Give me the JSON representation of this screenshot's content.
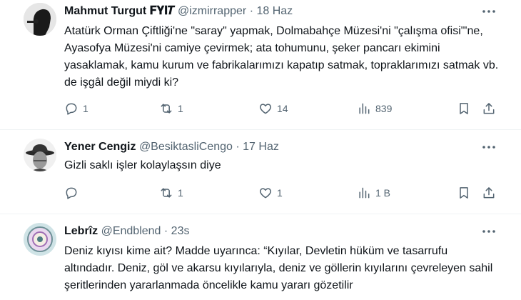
{
  "tweets": [
    {
      "name": "Mahmut Turgut 𝐅𝐘𝐈𝑻",
      "handle": "@izmirrapper",
      "sep": "·",
      "time": "18 Haz",
      "body": "Atatürk Orman Çiftliği'ne \"saray\" yapmak, Dolmabahçe Müzesi'ni \"çalışma ofisi\"'ne, Ayasofya Müzesi'ni camiye çevirmek; ata tohumunu, şeker pancarı ekimini yasaklamak, kamu kurum ve fabrikalarımızı kapatıp satmak, topraklarımızı satmak vb. de işgâl değil miydi ki?",
      "replies": "1",
      "retweets": "1",
      "likes": "14",
      "views": "839"
    },
    {
      "name": "Yener Cengiz",
      "handle": "@BesiktasliCengo",
      "sep": "·",
      "time": "17 Haz",
      "body": "Gizli saklı işler kolaylaşsın diye",
      "replies": "",
      "retweets": "1",
      "likes": "1",
      "views": "1 B"
    },
    {
      "name": "Lebrîz",
      "handle": "@Endblend",
      "sep": "·",
      "time": "23s",
      "body": "Deniz kıyısı kime ait? Madde uyarınca: “Kıyılar, Devletin hüküm ve tasarrufu altındadır. Deniz, göl ve akarsu kıyılarıyla, deniz ve göllerin kıyılarını çevreleyen sahil şeritlerinden yararlanmada öncelikle kamu yararı gözetilir"
    }
  ],
  "icons": {
    "more": "more-horizontal-icon",
    "reply": "reply-icon",
    "retweet": "retweet-icon",
    "like": "heart-icon",
    "views": "views-chart-icon",
    "bookmark": "bookmark-icon",
    "share": "share-icon"
  },
  "colors": {
    "text": "#0f1419",
    "muted": "#536471",
    "divider": "#eff3f4"
  }
}
